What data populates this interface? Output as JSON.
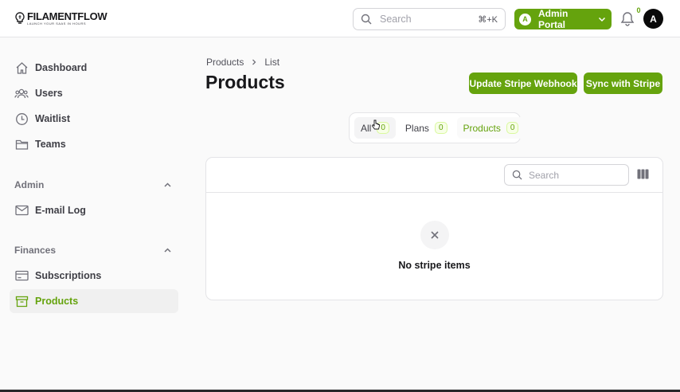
{
  "brand": {
    "name": "FILAMENTFLOW",
    "tagline": "LAUNCH YOUR SAAS IN HOURS"
  },
  "topbar": {
    "search_placeholder": "Search",
    "search_shortcut": "⌘+K",
    "portal_initial": "A",
    "portal_label": "Admin Portal",
    "notification_count": "0",
    "user_initial": "A"
  },
  "sidebar": {
    "items": [
      {
        "label": "Dashboard",
        "icon": "home-icon"
      },
      {
        "label": "Users",
        "icon": "users-icon"
      },
      {
        "label": "Waitlist",
        "icon": "clock-icon"
      },
      {
        "label": "Teams",
        "icon": "folder-icon"
      }
    ],
    "admin_group": {
      "label": "Admin",
      "items": [
        {
          "label": "E-mail Log",
          "icon": "envelope-icon"
        }
      ]
    },
    "finances_group": {
      "label": "Finances",
      "items": [
        {
          "label": "Subscriptions",
          "icon": "credit-card-icon"
        },
        {
          "label": "Products",
          "icon": "archive-box-icon",
          "active": true
        }
      ]
    }
  },
  "main": {
    "breadcrumb": [
      "Products",
      "List"
    ],
    "title": "Products",
    "actions": {
      "update_webhook": "Update Stripe Webhook",
      "sync": "Sync with Stripe"
    },
    "tabs": [
      {
        "label": "All",
        "count": "0"
      },
      {
        "label": "Plans",
        "count": "0"
      },
      {
        "label": "Products",
        "count": "0"
      }
    ],
    "table": {
      "search_placeholder": "Search",
      "empty_message": "No stripe items"
    }
  },
  "colors": {
    "accent": "#65a30d",
    "text": "#18181b",
    "muted": "#71717a",
    "border": "#e4e4e7"
  }
}
